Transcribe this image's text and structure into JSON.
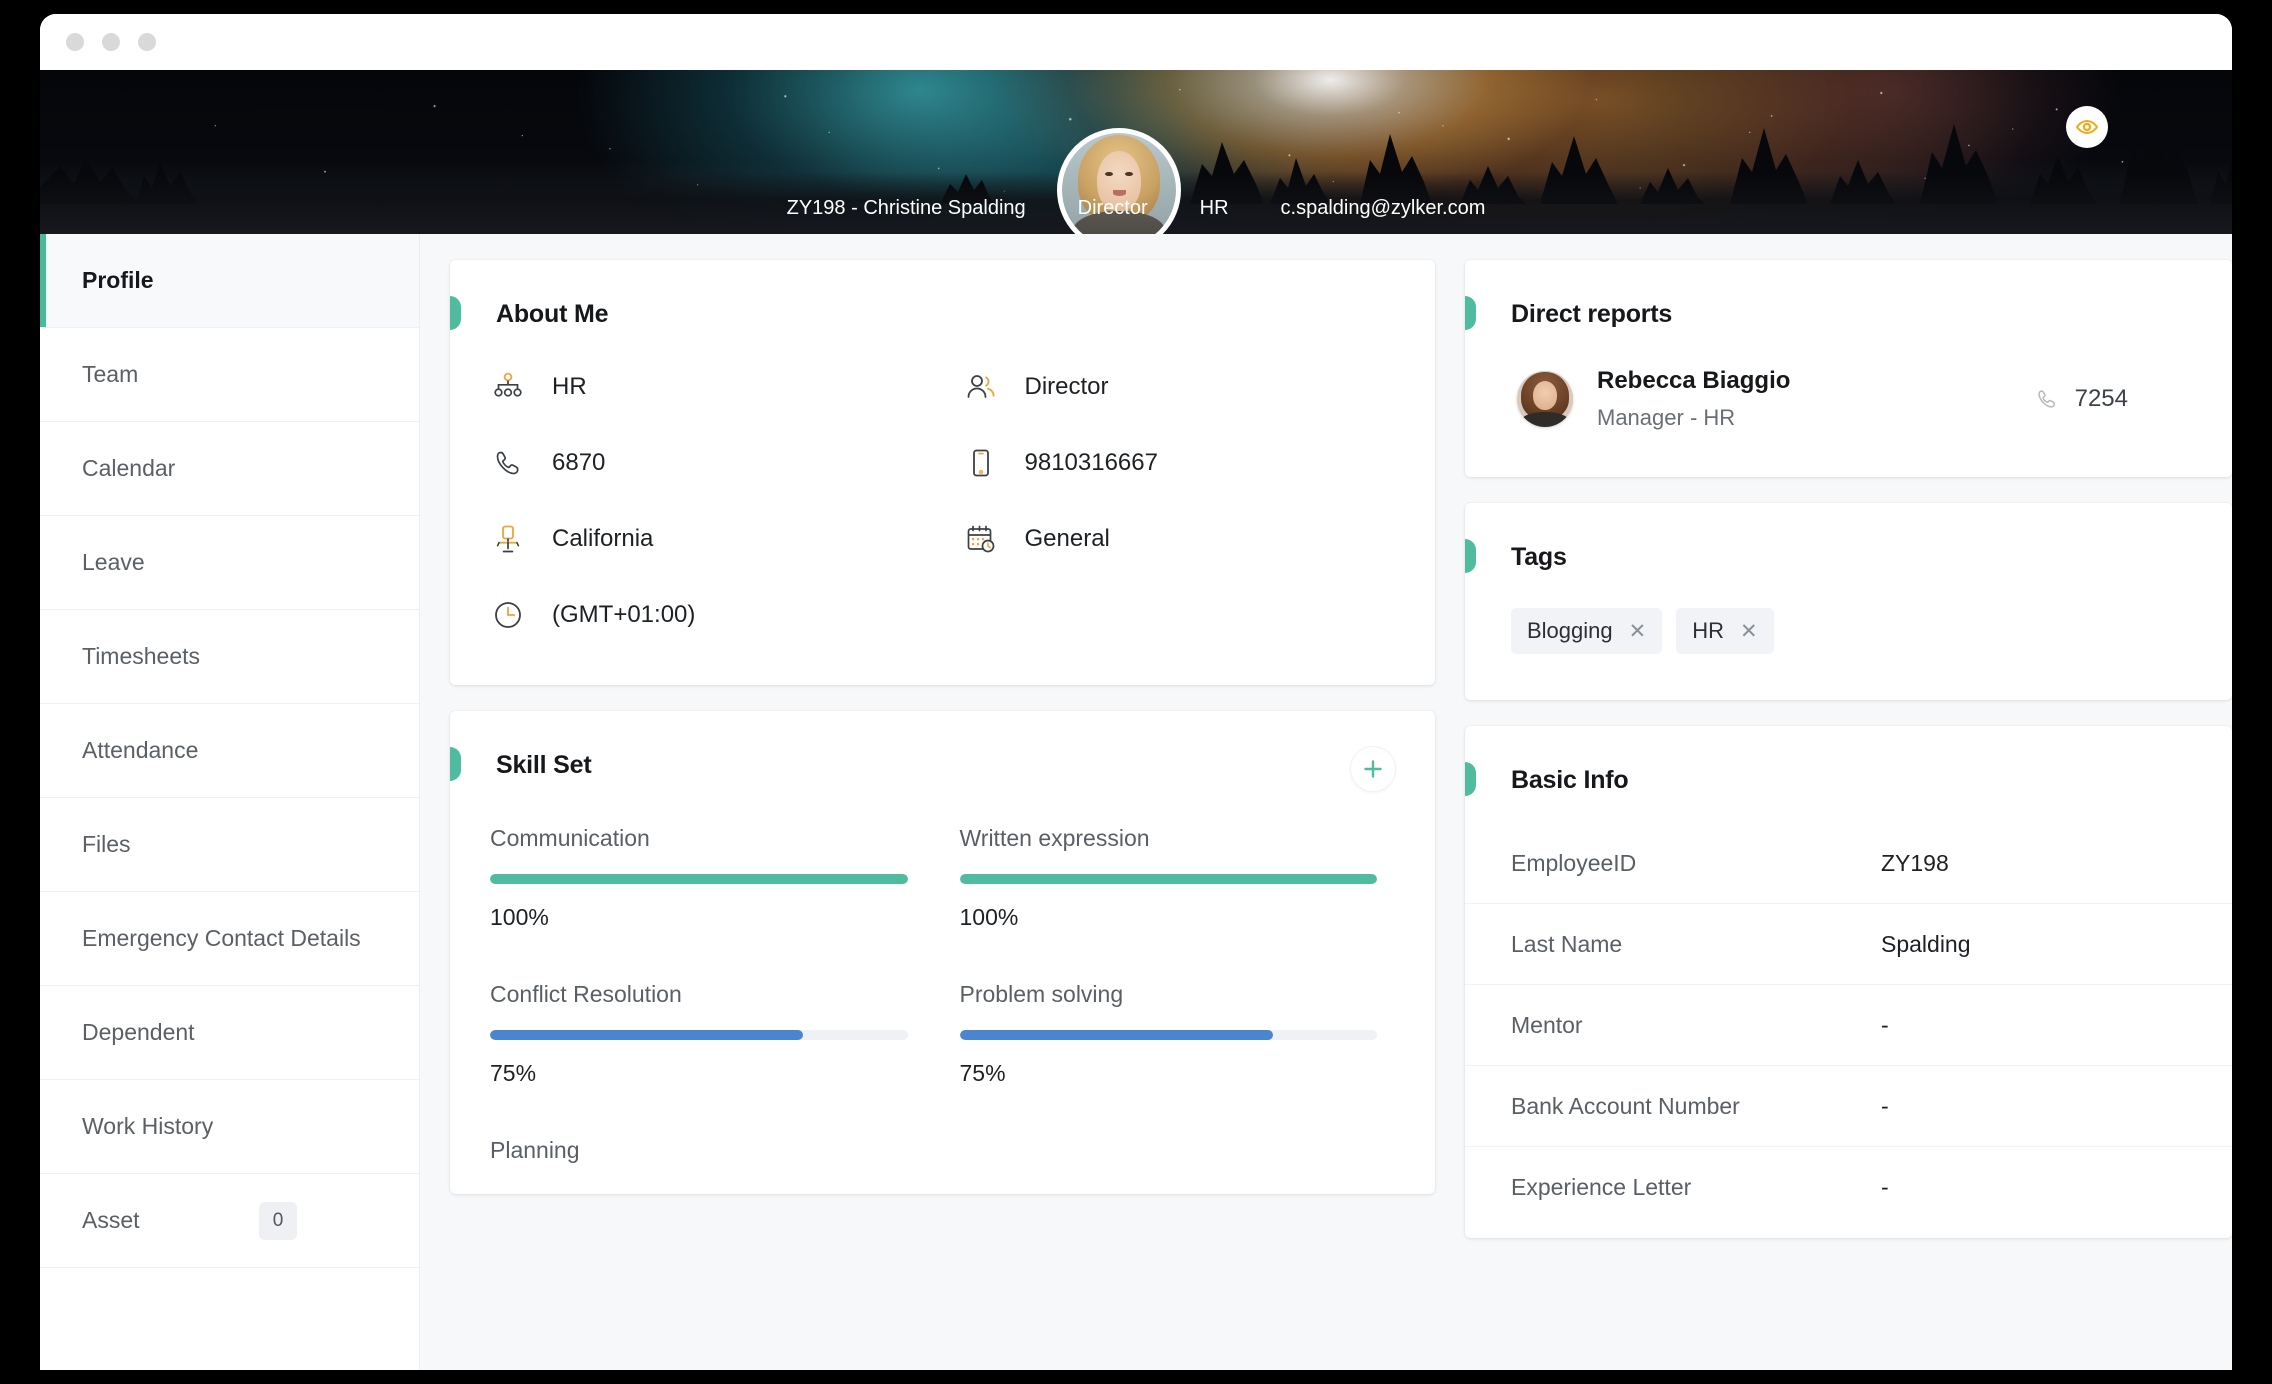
{
  "window": {
    "traffic_lights": [
      "close",
      "minimize",
      "maximize"
    ]
  },
  "banner": {
    "employee_id_name": "ZY198 - Christine Spalding",
    "designation": "Director",
    "department": "HR",
    "email": "c.spalding@zylker.com",
    "preview_icon": "eye-icon",
    "avatar_alt": "Christine Spalding",
    "accent_green": "#4fbb9f"
  },
  "sidebar": {
    "items": [
      {
        "label": "Profile",
        "active": true,
        "badge": null
      },
      {
        "label": "Team",
        "active": false,
        "badge": null
      },
      {
        "label": "Calendar",
        "active": false,
        "badge": null
      },
      {
        "label": "Leave",
        "active": false,
        "badge": null
      },
      {
        "label": "Timesheets",
        "active": false,
        "badge": null
      },
      {
        "label": "Attendance",
        "active": false,
        "badge": null
      },
      {
        "label": "Files",
        "active": false,
        "badge": null
      },
      {
        "label": "Emergency Contact Details",
        "active": false,
        "badge": null
      },
      {
        "label": "Dependent",
        "active": false,
        "badge": null
      },
      {
        "label": "Work History",
        "active": false,
        "badge": null
      },
      {
        "label": "Asset",
        "active": false,
        "badge": "0"
      }
    ]
  },
  "about_me": {
    "title": "About Me",
    "items": [
      {
        "icon": "org-chart-icon",
        "value": "HR"
      },
      {
        "icon": "people-icon",
        "value": "Director"
      },
      {
        "icon": "phone-icon",
        "value": "6870"
      },
      {
        "icon": "mobile-icon",
        "value": "9810316667"
      },
      {
        "icon": "office-chair-icon",
        "value": "California"
      },
      {
        "icon": "calendar-clock-icon",
        "value": "General"
      },
      {
        "icon": "clock-icon",
        "value": "(GMT+01:00)"
      }
    ]
  },
  "skill_set": {
    "title": "Skill Set",
    "add_icon": "plus-icon",
    "green": "#4fbb9f",
    "blue": "#4a86d0",
    "skills": [
      {
        "name": "Communication",
        "percent": 100,
        "label": "100%",
        "color": "#4fbb9f"
      },
      {
        "name": "Written expression",
        "percent": 100,
        "label": "100%",
        "color": "#4fbb9f"
      },
      {
        "name": "Conflict Resolution",
        "percent": 75,
        "label": "75%",
        "color": "#4a86d0"
      },
      {
        "name": "Problem solving",
        "percent": 75,
        "label": "75%",
        "color": "#4a86d0"
      },
      {
        "name": "Planning",
        "percent": 0,
        "label": "",
        "color": "#4a86d0"
      }
    ]
  },
  "direct_reports": {
    "title": "Direct reports",
    "people": [
      {
        "name": "Rebecca Biaggio",
        "role": "Manager - HR",
        "phone": "7254",
        "phone_icon": "phone-icon"
      }
    ]
  },
  "tags": {
    "title": "Tags",
    "items": [
      {
        "label": "Blogging",
        "remove_icon": "close-icon"
      },
      {
        "label": "HR",
        "remove_icon": "close-icon"
      }
    ]
  },
  "basic_info": {
    "title": "Basic Info",
    "rows": [
      {
        "label": "EmployeeID",
        "value": "ZY198"
      },
      {
        "label": "Last Name",
        "value": "Spalding"
      },
      {
        "label": "Mentor",
        "value": "-"
      },
      {
        "label": "Bank Account Number",
        "value": "-"
      },
      {
        "label": "Experience Letter",
        "value": "-"
      }
    ]
  }
}
